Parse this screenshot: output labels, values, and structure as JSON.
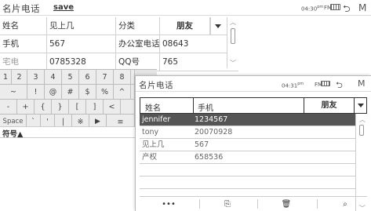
{
  "back": {
    "app_title": "名片电话",
    "save_label": "save",
    "time": "04:30",
    "ampm": "pm",
    "mode": "FM",
    "fields": {
      "row1": [
        "姓名",
        "见上几",
        "分类",
        "朋友"
      ],
      "row2": [
        "手机",
        "567",
        "办公室电话",
        "08643"
      ],
      "row3": [
        "宅电",
        "0785328",
        "QQ号",
        "765"
      ]
    },
    "keyboard": {
      "row1": [
        "1",
        "2",
        "3",
        "4",
        "5",
        "6",
        "7",
        "8",
        "9",
        "0",
        "-",
        "=",
        "⇐"
      ],
      "row2": [
        "~",
        "!",
        "@",
        "#",
        "$",
        "%",
        "^"
      ],
      "row3": [
        "-",
        "+",
        "{",
        "}",
        "[",
        "]",
        "<"
      ],
      "row4": [
        "Space",
        "`",
        "'",
        "|",
        "※",
        "▶",
        "≡"
      ],
      "status": "符号▲"
    }
  },
  "front": {
    "app_title": "名片电话",
    "time": "04:31",
    "ampm": "pm",
    "mode": "FM",
    "table": {
      "col_name": "姓名",
      "col_phone": "手机",
      "category": "朋友",
      "rows": [
        {
          "name": "jennifer",
          "phone": "1234567"
        },
        {
          "name": "tony",
          "phone": "20070928"
        },
        {
          "name": "见上几",
          "phone": "567"
        },
        {
          "name": "产权",
          "phone": "658536"
        },
        {
          "name": "",
          "phone": ""
        },
        {
          "name": "",
          "phone": ""
        }
      ]
    },
    "bottom_bar": {
      "more": "•••",
      "new": "⎘",
      "delete": "🗑",
      "search": "⌕"
    }
  }
}
